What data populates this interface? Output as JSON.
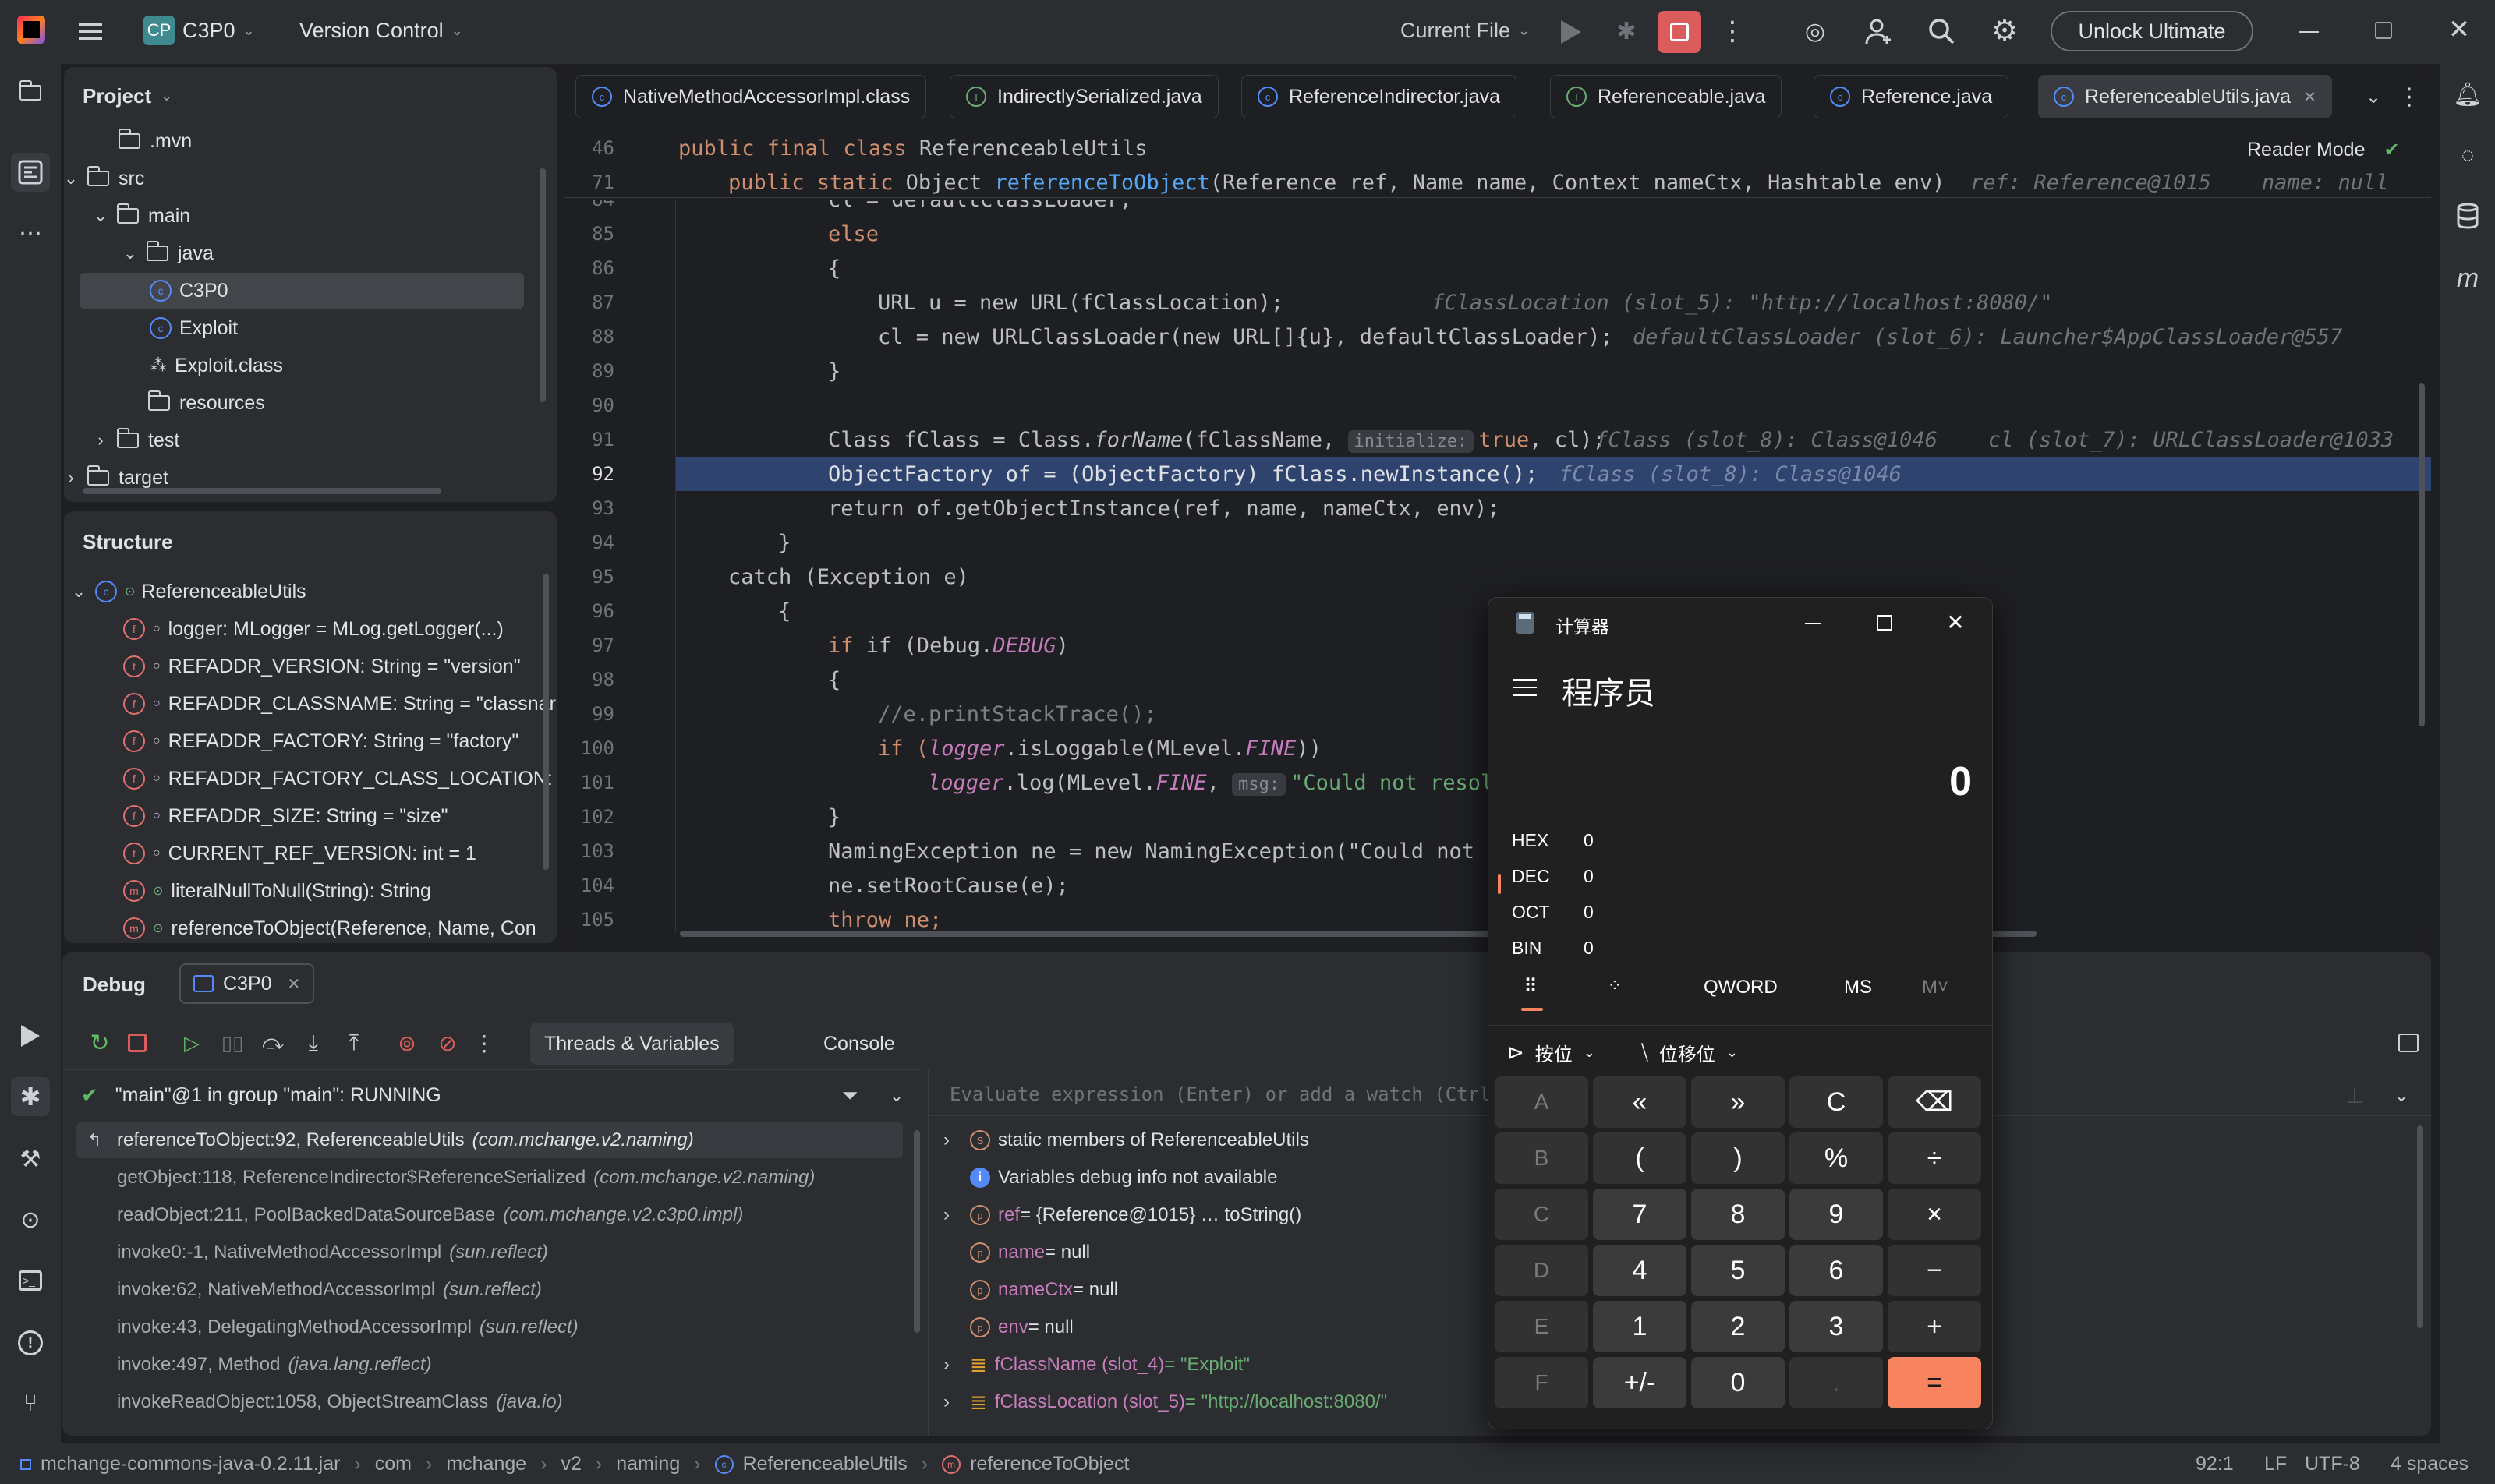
{
  "titlebar": {
    "project_badge": "CP",
    "project_name": "C3P0",
    "vcs_label": "Version Control",
    "run_config": "Current File",
    "unlock_label": "Unlock Ultimate"
  },
  "project_panel": {
    "title": "Project",
    "items": [
      {
        "label": ".mvn",
        "kind": "folder",
        "indent": 0,
        "chev": ""
      },
      {
        "label": "src",
        "kind": "folder",
        "indent": 0,
        "chev": "⌄"
      },
      {
        "label": "main",
        "kind": "folder",
        "indent": 1,
        "chev": "⌄"
      },
      {
        "label": "java",
        "kind": "folder",
        "indent": 2,
        "chev": "⌄"
      },
      {
        "label": "C3P0",
        "kind": "class",
        "indent": 3,
        "chev": ""
      },
      {
        "label": "Exploit",
        "kind": "class",
        "indent": 3,
        "chev": ""
      },
      {
        "label": "Exploit.class",
        "kind": "file",
        "indent": 3,
        "chev": ""
      },
      {
        "label": "resources",
        "kind": "folder",
        "indent": 2,
        "chev": ""
      },
      {
        "label": "test",
        "kind": "folder",
        "indent": 1,
        "chev": "›"
      },
      {
        "label": "target",
        "kind": "folder",
        "indent": 0,
        "chev": "›"
      }
    ]
  },
  "structure_panel": {
    "title": "Structure",
    "root": "ReferenceableUtils",
    "members": [
      "logger: MLogger = MLog.getLogger(...)",
      "REFADDR_VERSION: String = \"version\"",
      "REFADDR_CLASSNAME: String = \"classnar",
      "REFADDR_FACTORY: String = \"factory\"",
      "REFADDR_FACTORY_CLASS_LOCATION: S",
      "REFADDR_SIZE: String = \"size\"",
      "CURRENT_REF_VERSION: int = 1",
      "literalNullToNull(String): String",
      "referenceToObject(Reference, Name, Con"
    ]
  },
  "editor": {
    "tabs": [
      "NativeMethodAccessorImpl.class",
      "IndirectlySerialized.java",
      "ReferenceIndirector.java",
      "Referenceable.java",
      "Reference.java",
      "ReferenceableUtils.java"
    ],
    "reader_mode": "Reader Mode",
    "sticky": [
      {
        "ln": "46",
        "text": "public final class ReferenceableUtils"
      },
      {
        "ln": "71",
        "text": "public static Object referenceToObject(Reference ref, Name name, Context nameCtx, Hashtable env)",
        "hint": "ref: Reference@1015    name: null    n"
      }
    ],
    "lines": {
      "84": "cl = defaultClassLoader;",
      "85": "else",
      "86": "{",
      "87": "URL u = new URL(fClassLocation);",
      "87h": "fClassLocation (slot_5): \"http://localhost:8080/\"",
      "88": "cl = new URLClassLoader(new URL[]{u}, defaultClassLoader);",
      "88h": "defaultClassLoader (slot_6): Launcher$AppClassLoader@557",
      "89": "}",
      "90": "",
      "91a": "Class fClass = Class.",
      "91b": "forName",
      "91c": "(fClassName,",
      "91i": "initialize:",
      "91d": "true",
      "91e": ", cl);",
      "91h": "fClass (slot_8): Class@1046    cl (slot_7): URLClassLoader@1033",
      "92": "ObjectFactory of = (ObjectFactory) fClass.newInstance();",
      "92h": "fClass (slot_8): Class@1046",
      "93": "return of.getObjectInstance(ref, name, nameCtx, env);",
      "94": "}",
      "95": "catch (Exception e)",
      "96": "{",
      "97a": "if (Debug.",
      "97b": "DEBUG",
      "97c": ")",
      "98": "{",
      "99": "//e.printStackTrace();",
      "100a": "if (",
      "100b": "logger",
      "100c": ".isLoggable(MLevel.",
      "100d": "FINE",
      "100e": "))",
      "101a": "logger",
      "101b": ".log(MLevel.",
      "101c": "FINE",
      "101d": ", ",
      "101i": "msg:",
      "101e": "\"Could not resol",
      "102": "}",
      "103": "NamingException ne = new NamingException(\"Could not r",
      "104": "ne.setRootCause(e);",
      "105": "throw ne;"
    }
  },
  "debug": {
    "title": "Debug",
    "session_tab": "C3P0",
    "threads_tab": "Threads & Variables",
    "console_tab": "Console",
    "thread": "\"main\"@1 in group \"main\": RUNNING",
    "eval_placeholder": "Evaluate expression (Enter) or add a watch (Ctrl+S",
    "frames": [
      {
        "method": "referenceToObject:92, ReferenceableUtils",
        "pkg": "(com.mchange.v2.naming)"
      },
      {
        "method": "getObject:118, ReferenceIndirector$ReferenceSerialized",
        "pkg": "(com.mchange.v2.naming)"
      },
      {
        "method": "readObject:211, PoolBackedDataSourceBase",
        "pkg": "(com.mchange.v2.c3p0.impl)"
      },
      {
        "method": "invoke0:-1, NativeMethodAccessorImpl",
        "pkg": "(sun.reflect)"
      },
      {
        "method": "invoke:62, NativeMethodAccessorImpl",
        "pkg": "(sun.reflect)"
      },
      {
        "method": "invoke:43, DelegatingMethodAccessorImpl",
        "pkg": "(sun.reflect)"
      },
      {
        "method": "invoke:497, Method",
        "pkg": "(java.lang.reflect)"
      },
      {
        "method": "invokeReadObject:1058, ObjectStreamClass",
        "pkg": "(java.io)"
      }
    ],
    "variables": [
      {
        "expand": "›",
        "badge": "S",
        "name": "static members of ReferenceableUtils",
        "value": ""
      },
      {
        "expand": "",
        "badge": "i",
        "name": "Variables debug info not available",
        "value": ""
      },
      {
        "expand": "›",
        "badge": "p",
        "name": "ref",
        "value": " = {Reference@1015} … toString()"
      },
      {
        "expand": "",
        "badge": "p",
        "name": "name",
        "value": " = null"
      },
      {
        "expand": "",
        "badge": "p",
        "name": "nameCtx",
        "value": " = null"
      },
      {
        "expand": "",
        "badge": "p",
        "name": "env",
        "value": " = null"
      },
      {
        "expand": "›",
        "badge": "≡",
        "name": "fClassName (slot_4)",
        "value": " = \"Exploit\""
      },
      {
        "expand": "›",
        "badge": "≡",
        "name": "fClassLocation (slot_5)",
        "value": " = \"http://localhost:8080/\""
      }
    ]
  },
  "calculator": {
    "window_title": "计算器",
    "mode": "程序员",
    "display": "0",
    "bases": [
      {
        "label": "HEX",
        "value": "0"
      },
      {
        "label": "DEC",
        "value": "0"
      },
      {
        "label": "OCT",
        "value": "0"
      },
      {
        "label": "BIN",
        "value": "0"
      }
    ],
    "word_size": "QWORD",
    "mem_store": "MS",
    "mem_menu": "M˅",
    "bitwise_label": "按位",
    "bitshift_label": "位移位",
    "keys": [
      [
        "A",
        "«",
        "»",
        "C",
        "⌫"
      ],
      [
        "B",
        "(",
        ")",
        "%",
        "÷"
      ],
      [
        "C",
        "7",
        "8",
        "9",
        "×"
      ],
      [
        "D",
        "4",
        "5",
        "6",
        "−"
      ],
      [
        "E",
        "1",
        "2",
        "3",
        "+"
      ],
      [
        "F",
        "+/-",
        "0",
        ".",
        "="
      ]
    ]
  },
  "statusbar": {
    "breadcrumbs": [
      "mchange-commons-java-0.2.11.jar",
      "com",
      "mchange",
      "v2",
      "naming",
      "ReferenceableUtils",
      "referenceToObject"
    ],
    "position": "92:1",
    "line_sep": "LF",
    "encoding": "UTF-8",
    "indent": "4 spaces"
  },
  "colors": {
    "accent": "#3574f0",
    "debug_line": "#2e436e",
    "calc_equals": "#f7845e",
    "stop": "#db5c5c"
  }
}
